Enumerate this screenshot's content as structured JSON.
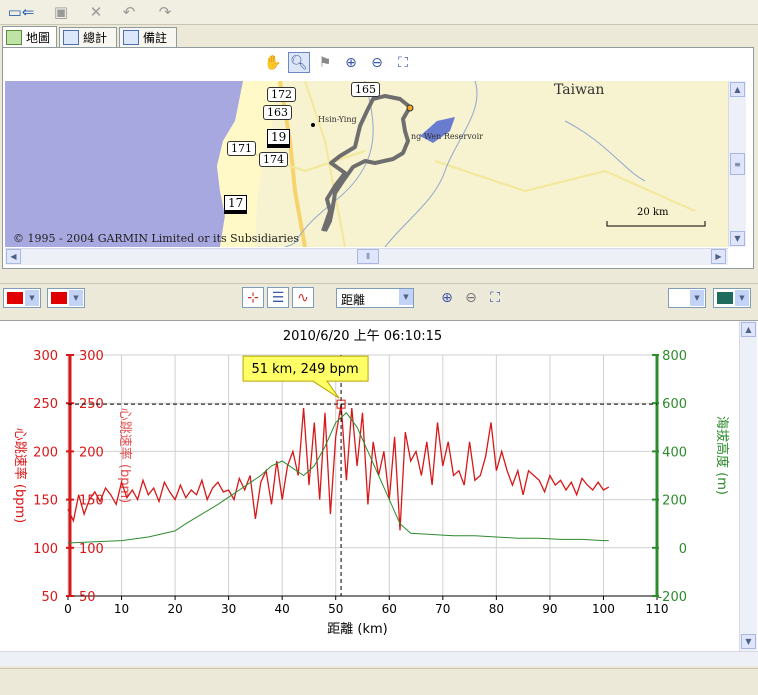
{
  "toolbar": {
    "icons": [
      "device-icon",
      "save-icon",
      "delete-icon",
      "undo-icon",
      "redo-icon"
    ]
  },
  "tabs": [
    {
      "label": "地圖",
      "icon": "map-icon",
      "active": true
    },
    {
      "label": "總計",
      "icon": "list-icon",
      "active": false
    },
    {
      "label": "備註",
      "icon": "notes-icon",
      "active": false
    }
  ],
  "map": {
    "region_label": "Taiwan",
    "city_label": "Hsin-Ying",
    "reservoir_label": "ng Wen Reservoir",
    "scale_label": "20 km",
    "copyright": "© 1995 - 2004 GARMIN Limited or its Subsidiaries",
    "road_labels": [
      "172",
      "163",
      "19",
      "171",
      "174",
      "165",
      "17"
    ]
  },
  "chart_controls": {
    "left_color_1": "#e00000",
    "left_color_2": "#e00000",
    "xaxis_select": "距離",
    "right_color_1": "#ffffff",
    "right_color_2": "#1e6b5e"
  },
  "colors": {
    "heart": "#d81818",
    "elevation": "#2e8b2e",
    "highlight": "#ffff66"
  },
  "chart_data": {
    "type": "line",
    "title": "2010/6/20 上午 06:10:15",
    "xlabel": "距離 (km)",
    "ylabel_left": "心跳速率 (bpm)",
    "ylabel_right": "海拔高度 (m)",
    "xlim": [
      0,
      110
    ],
    "ylim_left": [
      50,
      300
    ],
    "ylim_right": [
      -200,
      800
    ],
    "x_ticks": [
      0,
      10,
      20,
      30,
      40,
      50,
      60,
      70,
      80,
      90,
      100,
      110
    ],
    "y_ticks_left": [
      50,
      100,
      150,
      200,
      250,
      300
    ],
    "y_ticks_right": [
      -200,
      0,
      200,
      400,
      600,
      800
    ],
    "grid": true,
    "cursor": {
      "x": 51,
      "y": 249,
      "label": "51 km, 249 bpm"
    },
    "series": [
      {
        "name": "心跳速率 (bpm)",
        "axis": "left",
        "x": [
          0,
          1,
          2,
          3,
          4,
          5,
          6,
          7,
          8,
          9,
          10,
          11,
          12,
          13,
          14,
          15,
          16,
          17,
          18,
          19,
          20,
          21,
          22,
          23,
          24,
          25,
          26,
          27,
          28,
          29,
          30,
          31,
          32,
          33,
          34,
          35,
          36,
          37,
          38,
          39,
          40,
          41,
          42,
          43,
          44,
          45,
          46,
          47,
          48,
          49,
          50,
          51,
          52,
          53,
          54,
          55,
          56,
          57,
          58,
          59,
          60,
          61,
          62,
          63,
          64,
          65,
          66,
          67,
          68,
          69,
          70,
          71,
          72,
          73,
          74,
          75,
          76,
          77,
          78,
          79,
          80,
          81,
          82,
          83,
          84,
          85,
          86,
          87,
          88,
          89,
          90,
          91,
          92,
          93,
          94,
          95,
          96,
          97,
          98,
          99,
          100,
          101
        ],
        "values": [
          140,
          128,
          155,
          135,
          150,
          158,
          148,
          162,
          155,
          145,
          168,
          152,
          160,
          150,
          170,
          155,
          162,
          148,
          168,
          158,
          150,
          165,
          152,
          160,
          155,
          170,
          150,
          162,
          168,
          158,
          160,
          150,
          172,
          160,
          175,
          130,
          168,
          180,
          145,
          190,
          150,
          185,
          200,
          175,
          245,
          165,
          230,
          150,
          240,
          135,
          215,
          249,
          170,
          245,
          185,
          240,
          145,
          210,
          175,
          200,
          150,
          215,
          118,
          220,
          190,
          200,
          175,
          210,
          165,
          230,
          185,
          210,
          175,
          180,
          165,
          210,
          170,
          175,
          195,
          230,
          180,
          200,
          180,
          165,
          180,
          155,
          180,
          175,
          170,
          158,
          175,
          165,
          170,
          160,
          168,
          155,
          172,
          165,
          160,
          168,
          160,
          163
        ]
      },
      {
        "name": "海拔高度 (m)",
        "axis": "right",
        "x": [
          0,
          5,
          10,
          15,
          20,
          22,
          25,
          28,
          30,
          32,
          34,
          36,
          38,
          40,
          42,
          44,
          46,
          48,
          50,
          52,
          54,
          56,
          58,
          60,
          62,
          64,
          68,
          72,
          76,
          80,
          84,
          88,
          92,
          96,
          100,
          101
        ],
        "values": [
          20,
          25,
          30,
          45,
          70,
          100,
          140,
          180,
          210,
          240,
          270,
          300,
          340,
          360,
          330,
          300,
          340,
          420,
          520,
          560,
          500,
          400,
          300,
          200,
          100,
          60,
          55,
          50,
          50,
          45,
          40,
          40,
          35,
          35,
          30,
          30
        ]
      }
    ]
  }
}
